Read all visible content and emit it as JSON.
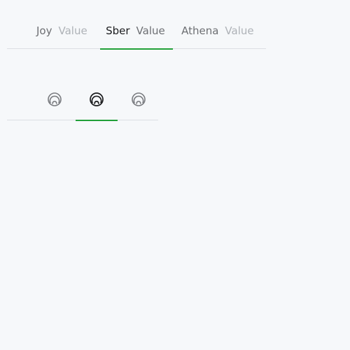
{
  "text_tabs": [
    {
      "label": "Joy",
      "value": "Value",
      "active": false
    },
    {
      "label": "Sber",
      "value": "Value",
      "active": true
    },
    {
      "label": "Athena",
      "value": "Value",
      "active": false
    }
  ],
  "icon_tabs": [
    {
      "icon": "assistant-icon",
      "active": false
    },
    {
      "icon": "assistant-icon",
      "active": true
    },
    {
      "icon": "assistant-icon",
      "active": false
    }
  ],
  "colors": {
    "accent": "#21a038",
    "text_active": "#1b1c1e",
    "text_inactive": "#6d6f73",
    "text_muted": "#aeb2b7",
    "divider": "#dcdfe3",
    "background": "#f6f8fa"
  }
}
